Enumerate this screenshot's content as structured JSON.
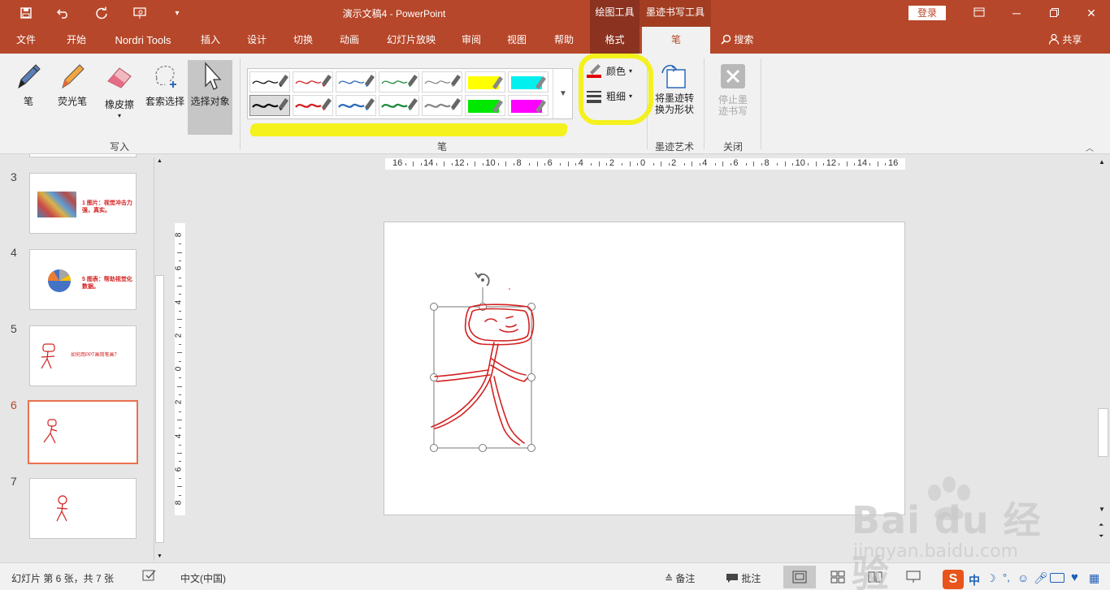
{
  "titlebar": {
    "doc_title": "演示文稿4  -  PowerPoint",
    "context_draw_tools": "绘图工具",
    "context_ink_tools": "墨迹书写工具",
    "login": "登录"
  },
  "tabs": [
    "文件",
    "开始",
    "Nordri Tools",
    "插入",
    "设计",
    "切换",
    "动画",
    "幻灯片放映",
    "审阅",
    "视图",
    "帮助",
    "格式",
    "笔"
  ],
  "search": "搜索",
  "share": "共享",
  "ribbon": {
    "write_group": {
      "pen": "笔",
      "highlighter": "荧光笔",
      "eraser": "橡皮擦",
      "lasso": "套索选择",
      "select_objects": "选择对象",
      "label": "写入"
    },
    "pens_group": {
      "label": "笔",
      "row1": [
        {
          "color": "#111111"
        },
        {
          "color": "#d32020"
        },
        {
          "color": "#2a6ab8"
        },
        {
          "color": "#1e8a3c"
        },
        {
          "color": "#888888"
        },
        {
          "color": "#ffff00"
        },
        {
          "color": "#00f0f0"
        }
      ],
      "row2": [
        {
          "color": "#111111"
        },
        {
          "color": "#d32020"
        },
        {
          "color": "#2a6ab8"
        },
        {
          "color": "#1e8a3c"
        },
        {
          "color": "#888888"
        },
        {
          "color": "#00e800"
        },
        {
          "color": "#ff00ff"
        }
      ]
    },
    "color_btn": "颜色",
    "thickness_btn": "粗细",
    "ink_art_group": {
      "convert": "将墨迹转换为形状",
      "label": "墨迹艺术"
    },
    "close_group": {
      "stop": "停止墨迹书写",
      "label": "关闭"
    }
  },
  "slides": [
    {
      "num": "3",
      "text": "1  图片：视觉冲击力强，真实。"
    },
    {
      "num": "4",
      "text": "5  图表：帮助视觉化数据。"
    },
    {
      "num": "5",
      "text": "如何用PPT画简笔画？"
    },
    {
      "num": "6",
      "text": ""
    },
    {
      "num": "7",
      "text": ""
    }
  ],
  "ruler": {
    "h_labels": [
      "16",
      "14",
      "12",
      "10",
      "8",
      "6",
      "4",
      "2",
      "0",
      "2",
      "4",
      "6",
      "8",
      "10",
      "12",
      "14",
      "16"
    ],
    "v_labels": [
      "8",
      "6",
      "4",
      "2",
      "0",
      "2",
      "4",
      "6",
      "8"
    ]
  },
  "statusbar": {
    "slide_info": "幻灯片 第 6 张，共 7 张",
    "language": "中文(中国)",
    "notes": "备注",
    "comments": "批注"
  },
  "watermark": {
    "logo": "Bai du 经验",
    "url": "jingyan.baidu.com"
  },
  "tray": {
    "ime": "中"
  },
  "colors": {
    "accent": "#b7472a",
    "highlight": "#f4f11d",
    "ink": "#d32020"
  }
}
